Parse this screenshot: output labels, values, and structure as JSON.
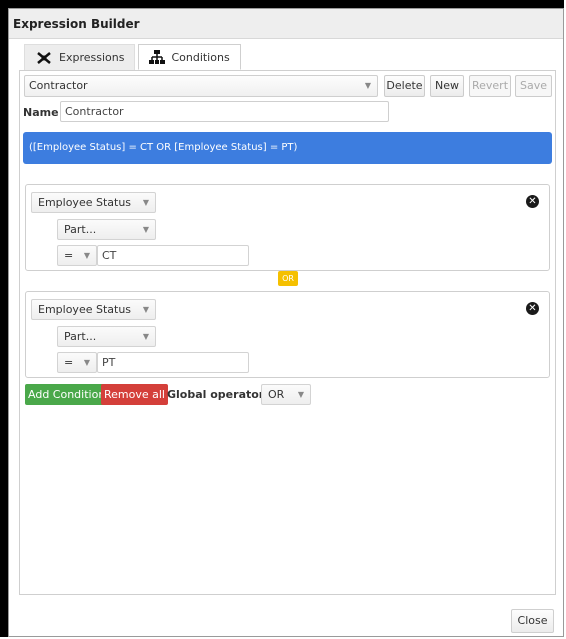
{
  "window": {
    "title": "Expression Builder"
  },
  "tabs": [
    {
      "label": "Expressions",
      "icon": "expressions-icon"
    },
    {
      "label": "Conditions",
      "icon": "conditions-icon"
    }
  ],
  "toolbar": {
    "selected": "Contractor",
    "delete": "Delete",
    "new": "New",
    "revert": "Revert",
    "save": "Save"
  },
  "name": {
    "label": "Name",
    "value": "Contractor"
  },
  "expression": "([Employee Status] = CT OR [Employee Status] = PT)",
  "conditions": [
    {
      "field": "Employee Status",
      "sub": "Part...",
      "operator": "=",
      "value": "CT"
    },
    {
      "field": "Employee Status",
      "sub": "Part...",
      "operator": "=",
      "value": "PT"
    }
  ],
  "connector": "OR",
  "actions": {
    "add": "Add Condition",
    "remove": "Remove all",
    "global_label": "Global operator:",
    "global_value": "OR"
  },
  "footer": {
    "close": "Close"
  },
  "colors": {
    "expression_bar": "#3d7ddf",
    "add_button": "#4aa84a",
    "remove_button": "#d43f3a",
    "or_badge": "#f5c000"
  }
}
